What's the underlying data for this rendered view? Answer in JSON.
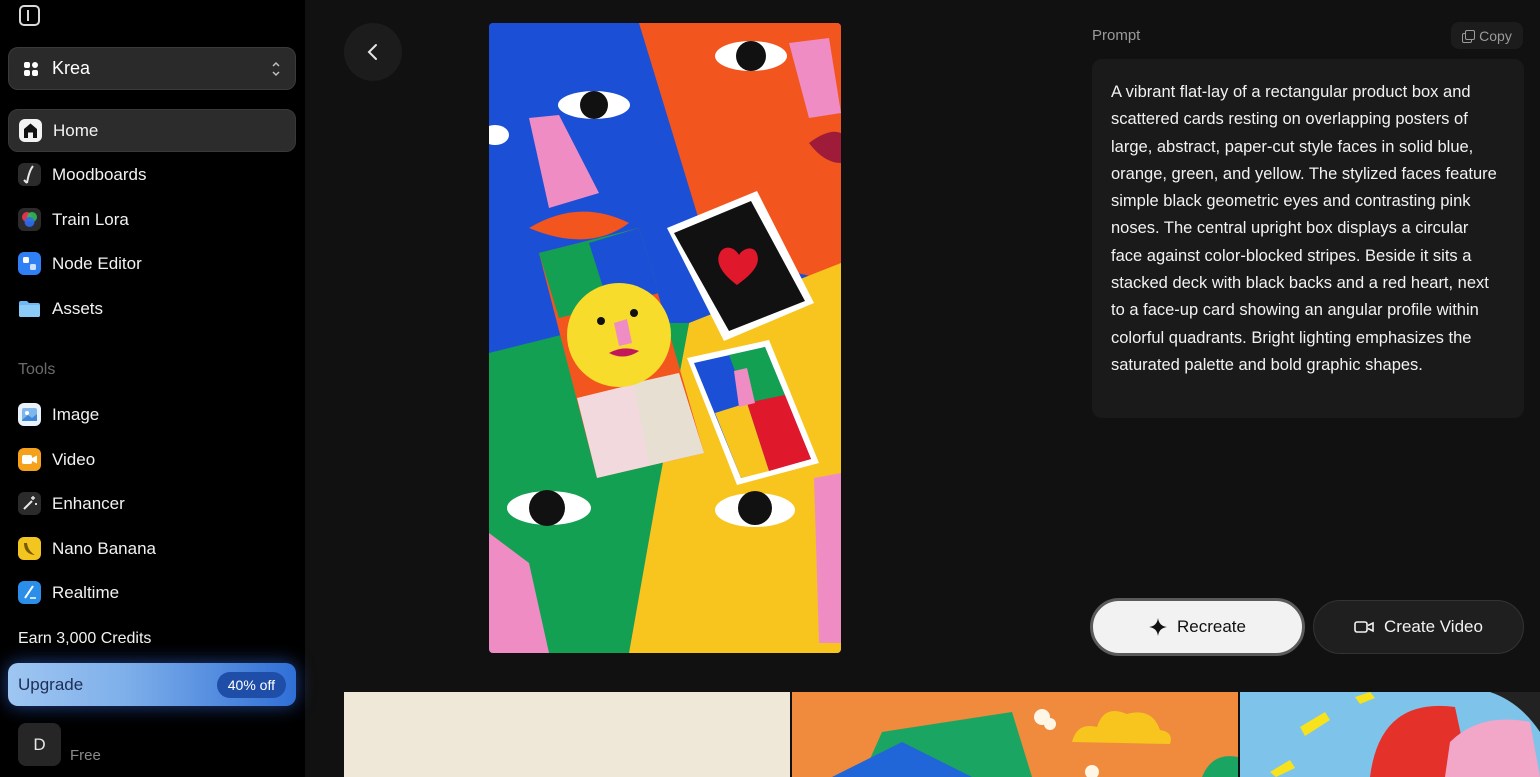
{
  "sidebar": {
    "workspace": {
      "label": "Krea"
    },
    "nav": [
      {
        "label": "Home",
        "icon": "home-icon",
        "active": true
      },
      {
        "label": "Moodboards",
        "icon": "moodboards-icon"
      },
      {
        "label": "Train Lora",
        "icon": "train-lora-icon"
      },
      {
        "label": "Node Editor",
        "icon": "node-editor-icon"
      },
      {
        "label": "Assets",
        "icon": "folder-icon"
      }
    ],
    "tools_title": "Tools",
    "tools": [
      {
        "label": "Image",
        "icon": "image-icon"
      },
      {
        "label": "Video",
        "icon": "video-icon"
      },
      {
        "label": "Enhancer",
        "icon": "enhancer-icon"
      },
      {
        "label": "Nano Banana",
        "icon": "banana-icon"
      },
      {
        "label": "Realtime",
        "icon": "realtime-icon"
      }
    ],
    "earn_credits": "Earn 3,000 Credits",
    "upgrade": {
      "label": "Upgrade",
      "badge": "40% off"
    },
    "user": {
      "initial": "D",
      "plan": "Free"
    }
  },
  "main": {
    "prompt": {
      "label": "Prompt",
      "copy_label": "Copy",
      "text": "A vibrant flat-lay of a rectangular product box and scattered cards resting on overlapping posters of large, abstract, paper-cut style faces in solid blue, orange, green, and yellow. The stylized faces feature simple black geometric eyes and contrasting pink noses. The central upright box displays a circular face against color-blocked stripes. Beside it sits a stacked deck with black backs and a red heart, next to a face-up card showing an angular profile within colorful quadrants. Bright lighting emphasizes the saturated palette and bold graphic shapes."
    },
    "actions": {
      "recreate": "Recreate",
      "create_video": "Create Video"
    }
  },
  "colors": {
    "background": "#111111",
    "sidebar": "#000000",
    "upgrade_accent": "#2f6fd6",
    "poster_blue": "#1b50d6",
    "poster_orange": "#f2551d",
    "poster_green": "#13a053",
    "poster_yellow": "#f7c51e",
    "poster_pink": "#f08cc4"
  }
}
